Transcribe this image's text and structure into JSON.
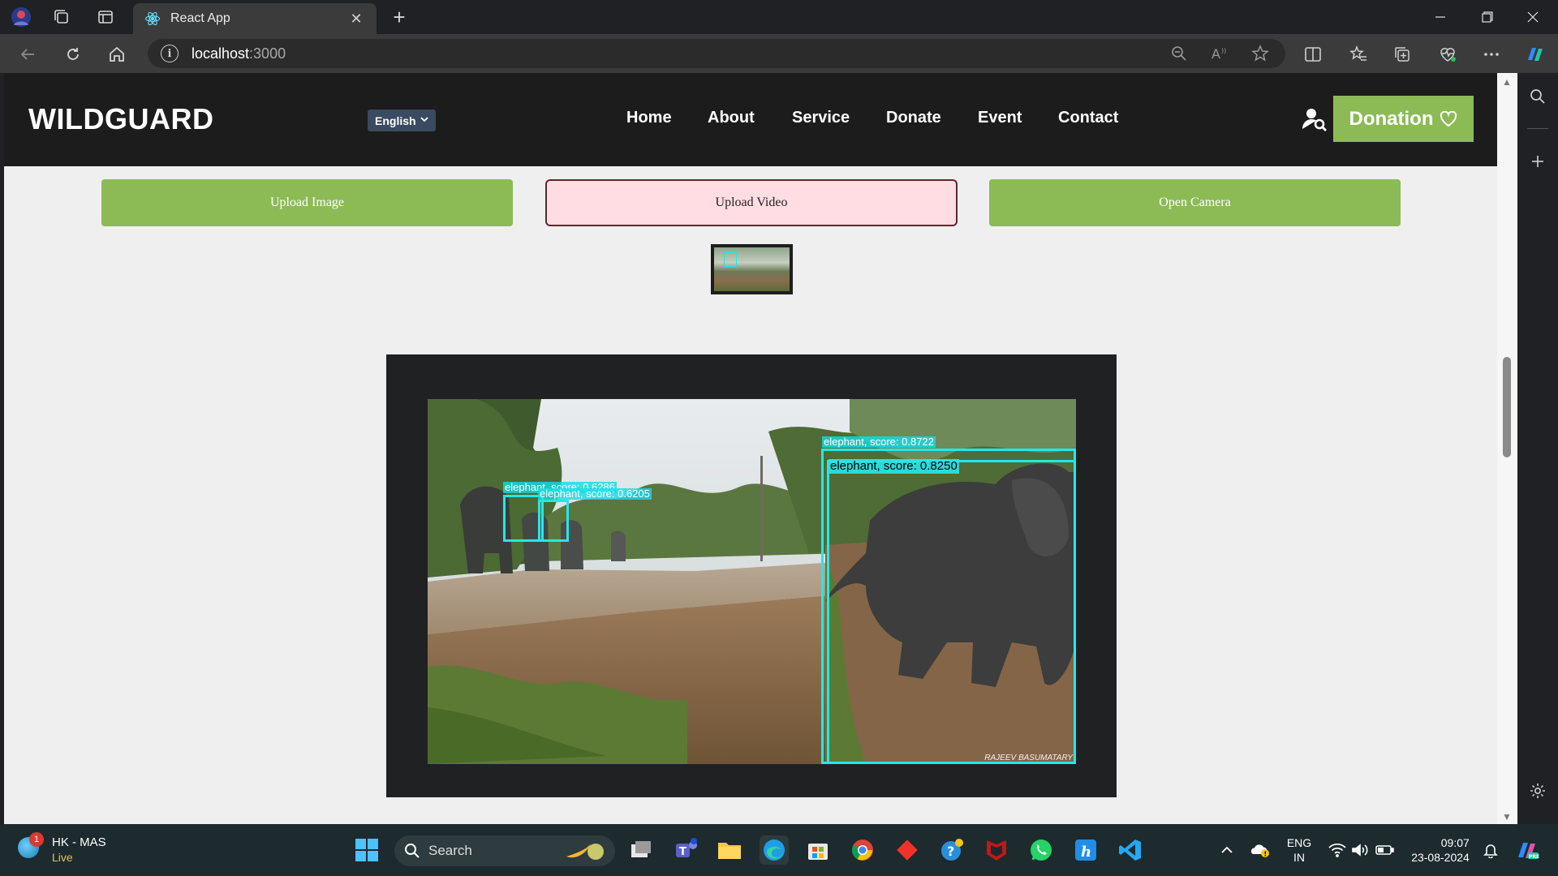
{
  "browser": {
    "tab_title": "React App",
    "url_host": "localhost",
    "url_port": ":3000"
  },
  "site": {
    "brand": "WILDGUARD",
    "language": "English",
    "menu": [
      "Home",
      "About",
      "Service",
      "Donate",
      "Event",
      "Contact"
    ],
    "donation_label": "Donation"
  },
  "actions": {
    "upload_image": "Upload Image",
    "upload_video": "Upload Video",
    "open_camera": "Open Camera"
  },
  "detections": [
    {
      "label": "elephant, score: 0.6286"
    },
    {
      "label": "elephant, score: 0.6205"
    },
    {
      "label": "elephant, score: 0.8722"
    },
    {
      "label": "elephant, score: 0.8250"
    }
  ],
  "video": {
    "watermark": "RAJEEV BASUMATARY"
  },
  "taskbar": {
    "weather_title": "HK - MAS",
    "weather_sub": "Live",
    "notification_count": "1",
    "search_placeholder": "Search",
    "lang_line1": "ENG",
    "lang_line2": "IN",
    "time": "09:07",
    "date": "23-08-2024"
  },
  "colors": {
    "accent_green": "#8cbb56",
    "detection_cyan": "#22e8ea",
    "nav_dark": "#1c1c1c"
  }
}
